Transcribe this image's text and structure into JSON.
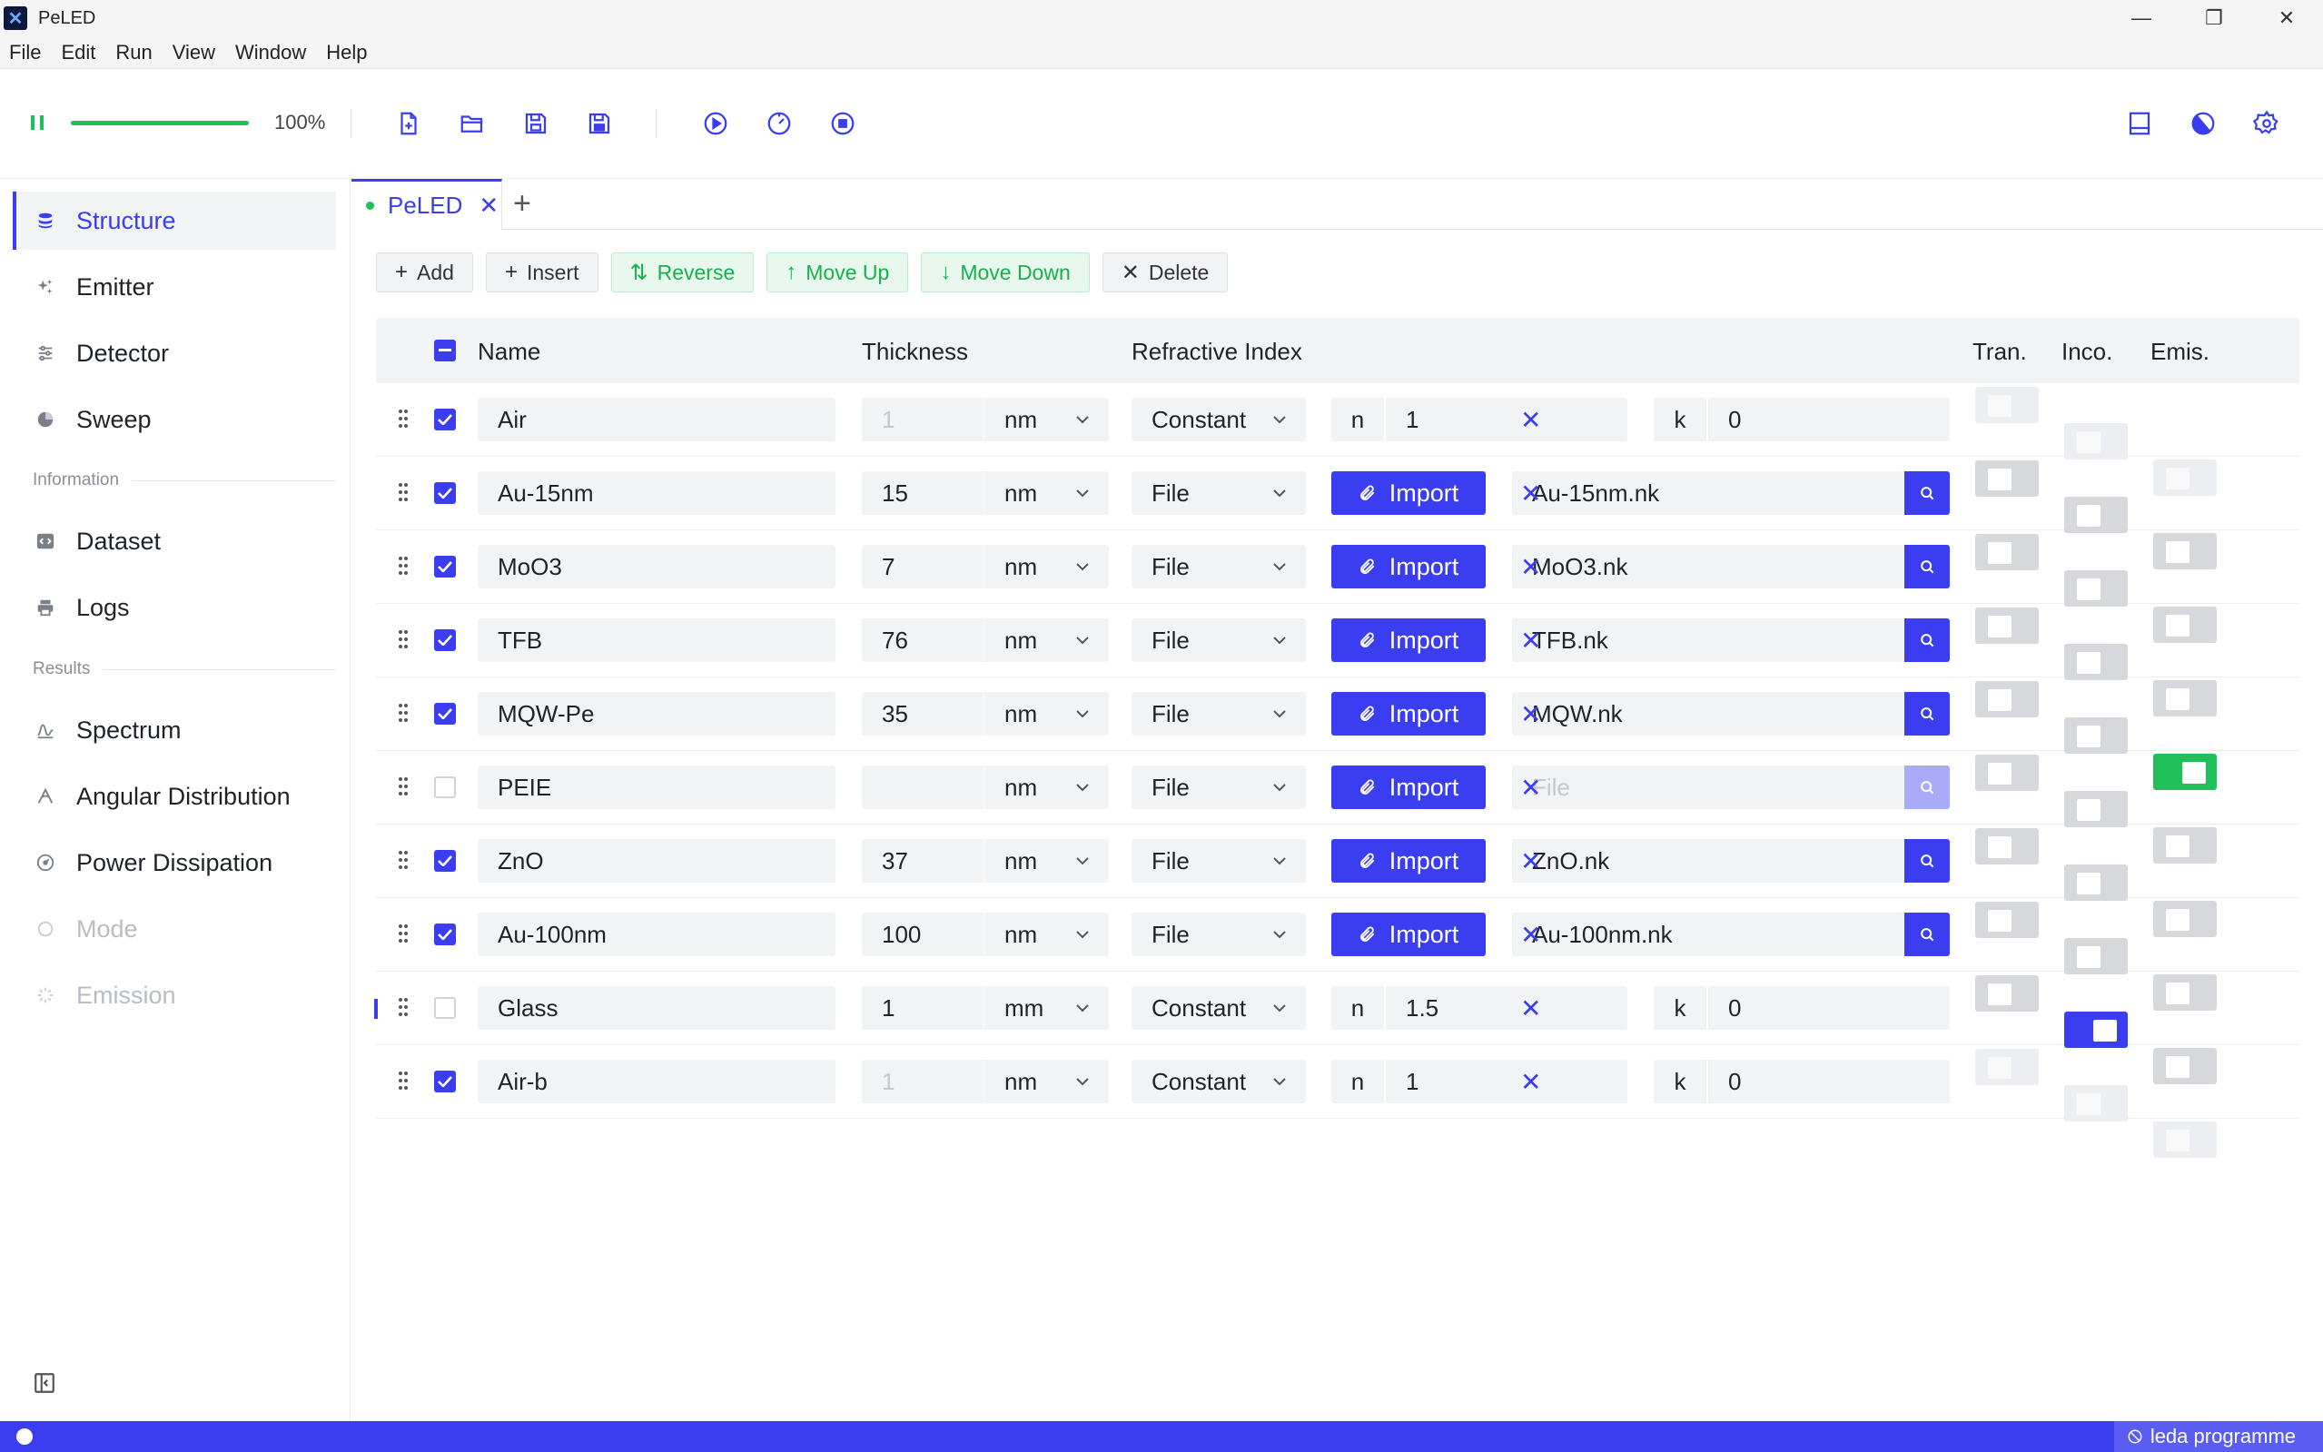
{
  "app": {
    "title": "PeLED",
    "icon_glyph": "✕"
  },
  "window_controls": {
    "minimize": "—",
    "restore": "❐",
    "close": "✕"
  },
  "menu": [
    "File",
    "Edit",
    "Run",
    "View",
    "Window",
    "Help"
  ],
  "toolbar": {
    "progress_percent": 100,
    "progress_text": "100%",
    "icons": [
      "new-file-icon",
      "open-folder-icon",
      "save-icon",
      "save-as-icon",
      "run-icon",
      "timer-icon",
      "stop-icon",
      "panel-icon",
      "theme-icon",
      "settings-icon"
    ]
  },
  "sidebar": {
    "items": [
      {
        "label": "Structure",
        "icon": "layers-icon",
        "state": "active"
      },
      {
        "label": "Emitter",
        "icon": "sparkle-icon",
        "state": "normal"
      },
      {
        "label": "Detector",
        "icon": "sliders-icon",
        "state": "normal"
      },
      {
        "label": "Sweep",
        "icon": "sweep-icon",
        "state": "normal"
      }
    ],
    "section_information": "Information",
    "info_items": [
      {
        "label": "Dataset",
        "icon": "code-icon"
      },
      {
        "label": "Logs",
        "icon": "printer-icon"
      }
    ],
    "section_results": "Results",
    "result_items": [
      {
        "label": "Spectrum",
        "icon": "spectrum-icon",
        "state": "normal"
      },
      {
        "label": "Angular Distribution",
        "icon": "angle-icon",
        "state": "normal"
      },
      {
        "label": "Power Dissipation",
        "icon": "gauge-icon",
        "state": "normal"
      },
      {
        "label": "Mode",
        "icon": "circle-icon",
        "state": "disabled"
      },
      {
        "label": "Emission",
        "icon": "loader-icon",
        "state": "disabled"
      }
    ]
  },
  "tabs": [
    {
      "label": "PeLED",
      "modified": true
    }
  ],
  "actions": {
    "add": "Add",
    "insert": "Insert",
    "reverse": "Reverse",
    "move_up": "Move Up",
    "move_down": "Move Down",
    "delete": "Delete"
  },
  "table": {
    "headers": {
      "name": "Name",
      "thickness": "Thickness",
      "refractive_index": "Refractive Index",
      "tran": "Tran.",
      "inco": "Inco.",
      "emis": "Emis."
    },
    "import_label": "Import",
    "file_placeholder": "File",
    "n_label": "n",
    "k_label": "k",
    "rows": [
      {
        "checked": true,
        "name": "Air",
        "thickness": "1",
        "thickness_dim": true,
        "unit": "nm",
        "mode": "Constant",
        "n": "1",
        "k": "0",
        "tran": "disabled",
        "inco": "disabled",
        "emis": "disabled"
      },
      {
        "checked": true,
        "name": "Au-15nm",
        "thickness": "15",
        "unit": "nm",
        "mode": "File",
        "file": "Au-15nm.nk",
        "tran": "off",
        "inco": "off",
        "emis": "off"
      },
      {
        "checked": true,
        "name": "MoO3",
        "thickness": "7",
        "unit": "nm",
        "mode": "File",
        "file": "MoO3.nk",
        "tran": "off",
        "inco": "off",
        "emis": "off"
      },
      {
        "checked": true,
        "name": "TFB",
        "thickness": "76",
        "unit": "nm",
        "mode": "File",
        "file": "TFB.nk",
        "tran": "off",
        "inco": "off",
        "emis": "off"
      },
      {
        "checked": true,
        "name": "MQW-Pe",
        "thickness": "35",
        "unit": "nm",
        "mode": "File",
        "file": "MQW.nk",
        "tran": "off",
        "inco": "off",
        "emis": "on-green"
      },
      {
        "checked": false,
        "name": "PEIE",
        "thickness": "",
        "unit": "nm",
        "mode": "File",
        "file": "",
        "tran": "off",
        "inco": "off",
        "emis": "off"
      },
      {
        "checked": true,
        "name": "ZnO",
        "thickness": "37",
        "unit": "nm",
        "mode": "File",
        "file": "ZnO.nk",
        "tran": "off",
        "inco": "off",
        "emis": "off"
      },
      {
        "checked": true,
        "name": "Au-100nm",
        "thickness": "100",
        "unit": "nm",
        "mode": "File",
        "file": "Au-100nm.nk",
        "tran": "off",
        "inco": "off",
        "emis": "off"
      },
      {
        "checked": false,
        "name": "Glass",
        "thickness": "1",
        "unit": "mm",
        "mode": "Constant",
        "n": "1.5",
        "k": "0",
        "tran": "off",
        "inco": "on-blue",
        "emis": "off",
        "drag_marker": true
      },
      {
        "checked": true,
        "name": "Air-b",
        "thickness": "1",
        "thickness_dim": true,
        "unit": "nm",
        "mode": "Constant",
        "n": "1",
        "k": "0",
        "tran": "disabled",
        "inco": "disabled",
        "emis": "disabled"
      }
    ]
  },
  "status": {
    "right_text": "leda programme"
  },
  "colors": {
    "accent": "#3a3ef0",
    "success": "#1fbf5a",
    "field_bg": "#f2f3f5"
  }
}
